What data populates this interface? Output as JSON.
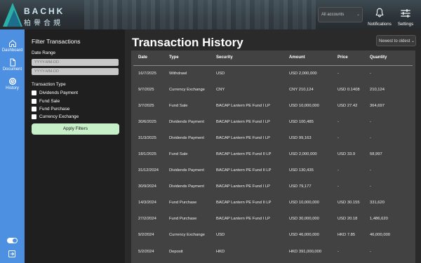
{
  "header": {
    "logo_text": "BACHK",
    "logo_sub": "柏譽合規",
    "account_select": "All accounts",
    "notifications_label": "Notifications",
    "settings_label": "Settings"
  },
  "sidebar": {
    "items": [
      {
        "label": "Dashboard",
        "icon": "home-icon"
      },
      {
        "label": "Document",
        "icon": "document-icon"
      },
      {
        "label": "History",
        "icon": "history-icon"
      }
    ]
  },
  "filter": {
    "title": "Filter Transactions",
    "date_range_label": "Date Range",
    "date_from_placeholder": "YYYY-MM-DD",
    "date_to_placeholder": "YYYY-MM-DD",
    "type_label": "Transaction Type",
    "types": [
      "Dividends Payment",
      "Fund Sale",
      "Fund Purchase",
      "Currency Exchange"
    ],
    "apply_label": "Apply Filters"
  },
  "main": {
    "title": "Transaction History",
    "sort": "Newest to oldest",
    "columns": [
      "Date",
      "Type",
      "Security",
      "Amount",
      "Price",
      "Quantity"
    ],
    "rows": [
      [
        "16/7/2025",
        "Withdrawl",
        "USD",
        "USD 2,000,000",
        "-",
        "-"
      ],
      [
        "9/7/2025",
        "Currency Exchange",
        "CNY",
        "CNY 210,124",
        "USD 0.1408",
        "210,124"
      ],
      [
        "3/7/2025",
        "Fund Sale",
        "BACAP Lantern PE Fund I LP",
        "USD 10,000,000",
        "USD 27.42",
        "364,697"
      ],
      [
        "30/6/2025",
        "Dividends Payment",
        "BACAP Lantern PE Fund I LP",
        "USD 100,485",
        "-",
        "-"
      ],
      [
        "31/3/2025",
        "Dividends Payment",
        "BACAP Lantern PE Fund I LP",
        "USD 99,163",
        "-",
        "-"
      ],
      [
        "18/1/2025",
        "Fund Sale",
        "BACAP Lantern PE Fund II LP",
        "USD 2,000,000",
        "USD 33.9",
        "58,997"
      ],
      [
        "31/12/2024",
        "Dividends Payment",
        "BACAP Lantern PE Fund II LP",
        "USD 130,435",
        "-",
        "-"
      ],
      [
        "30/9/2024",
        "Dividends Payment",
        "BACAP Lantern PE Fund I LP",
        "USD 79,177",
        "-",
        "-"
      ],
      [
        "14/3/2024",
        "Fund Purchase",
        "BACAP Lantern PE Fund II LP",
        "USD 10,000,000",
        "USD 30.155",
        "331,620"
      ],
      [
        "27/2/2024",
        "Fund Purchase",
        "BACAP Lantern PE Fund I LP",
        "USD 30,000,000",
        "USD 20.18",
        "1,486,620"
      ],
      [
        "9/2/2024",
        "Currency Exchange",
        "USD",
        "USD 46,000,000",
        "HKD 7.85",
        "46,000,000"
      ],
      [
        "5/2/2024",
        "Deposit",
        "HKD",
        "HKD 391,000,000",
        "-",
        "-"
      ]
    ]
  },
  "colors": {
    "sidebar": "#4d8fe0",
    "apply_button": "#c8f0c8",
    "logo_accent": "#2bb0a8"
  }
}
